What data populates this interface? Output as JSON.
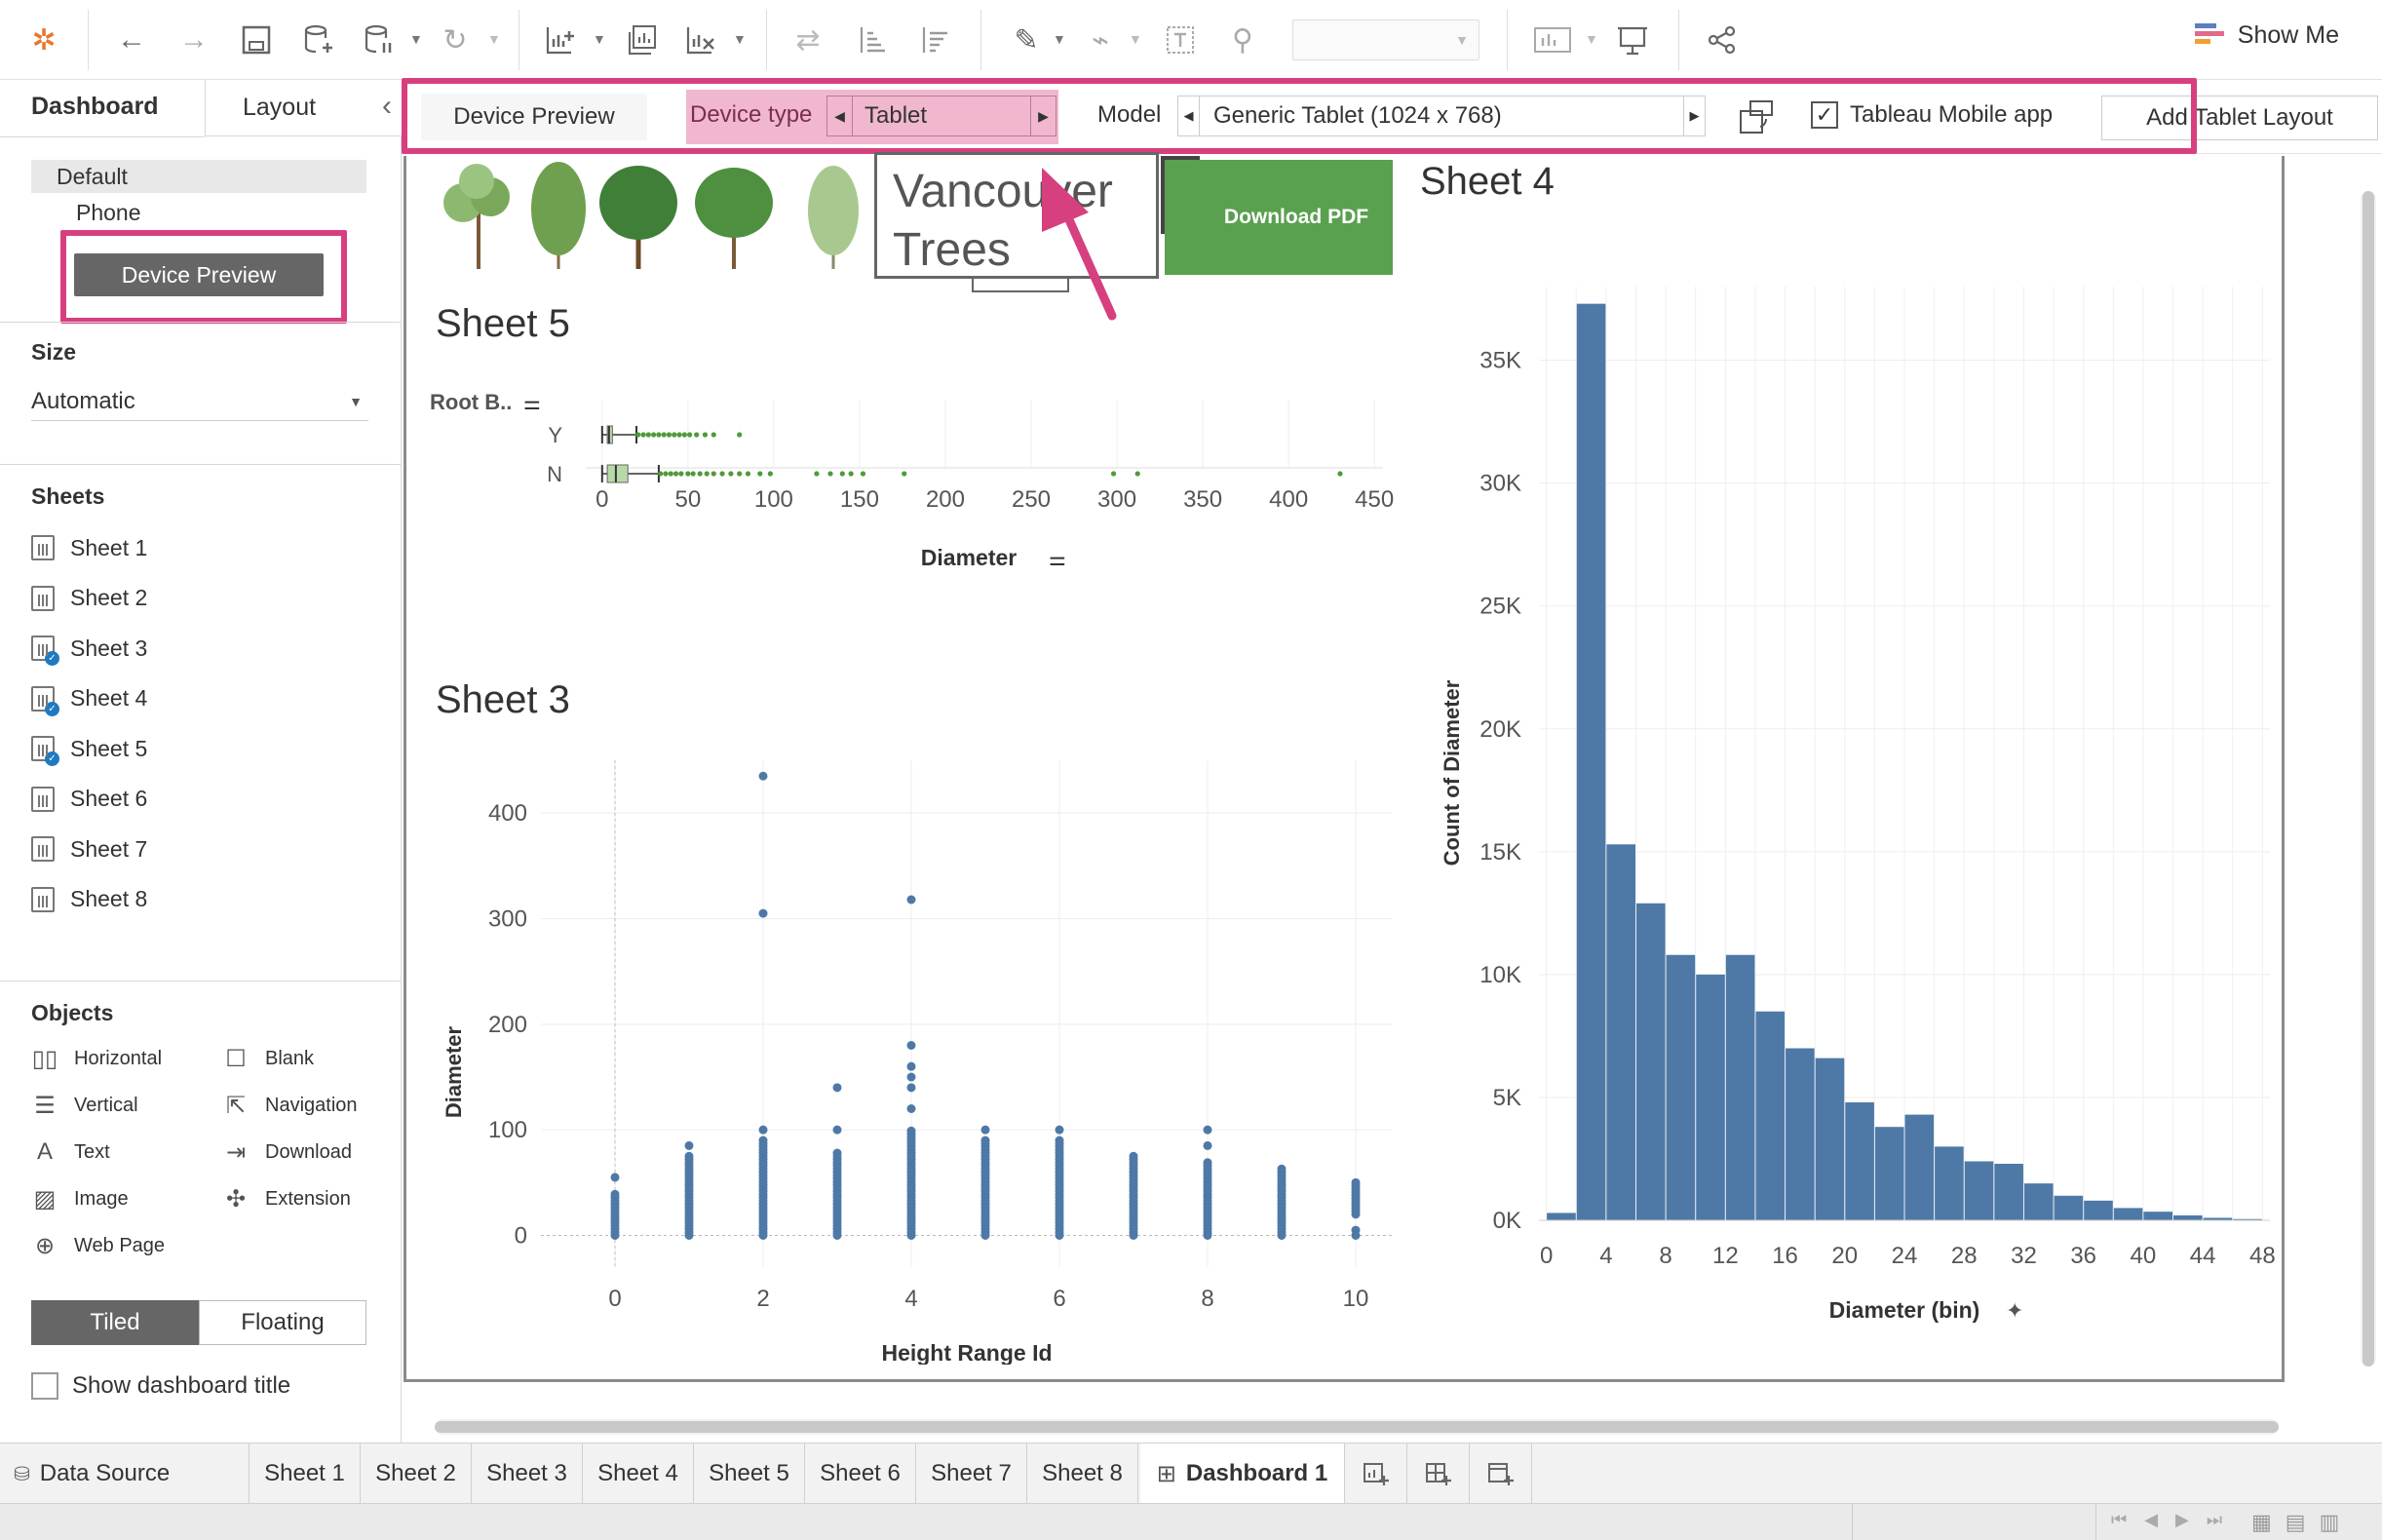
{
  "toolbar": {
    "show_me_label": "Show Me",
    "field_dropdown_value": "",
    "icons": [
      "tableau-logo-icon",
      "back-arrow-icon",
      "forward-arrow-icon",
      "save-icon",
      "new-datasource-icon",
      "pause-update-icon",
      "refresh-icon",
      "new-worksheet-icon",
      "duplicate-sheet-icon",
      "clear-sheet-icon",
      "swap-axes-icon",
      "sort-ascending-icon",
      "sort-descending-icon",
      "highlight-pen-icon",
      "group-paperclip-icon",
      "label-text-icon",
      "fix-axes-pin-icon",
      "show-cards-icon",
      "presentation-icon",
      "share-icon"
    ]
  },
  "left_panel": {
    "tabs": {
      "dashboard": "Dashboard",
      "layout": "Layout",
      "collapse_glyph": "‹"
    },
    "device_list": [
      "Default",
      "Phone"
    ],
    "device_preview_button": "Device Preview",
    "size": {
      "title": "Size",
      "value": "Automatic"
    },
    "sheets": {
      "title": "Sheets",
      "items": [
        {
          "label": "Sheet 1",
          "in_use": false
        },
        {
          "label": "Sheet 2",
          "in_use": false
        },
        {
          "label": "Sheet 3",
          "in_use": true
        },
        {
          "label": "Sheet 4",
          "in_use": true
        },
        {
          "label": "Sheet 5",
          "in_use": true
        },
        {
          "label": "Sheet 6",
          "in_use": false
        },
        {
          "label": "Sheet 7",
          "in_use": false
        },
        {
          "label": "Sheet 8",
          "in_use": false
        }
      ]
    },
    "objects": {
      "title": "Objects",
      "items": [
        {
          "label": "Horizontal",
          "icon": "horizontal-container-icon"
        },
        {
          "label": "Blank",
          "icon": "blank-icon"
        },
        {
          "label": "Vertical",
          "icon": "vertical-container-icon"
        },
        {
          "label": "Navigation",
          "icon": "navigation-icon"
        },
        {
          "label": "Text",
          "icon": "text-icon"
        },
        {
          "label": "Download",
          "icon": "download-icon"
        },
        {
          "label": "Image",
          "icon": "image-icon"
        },
        {
          "label": "Extension",
          "icon": "extension-icon"
        },
        {
          "label": "Web Page",
          "icon": "web-page-icon"
        }
      ]
    },
    "layout_toggle": {
      "tiled": "Tiled",
      "floating": "Floating"
    },
    "show_title": "Show dashboard title"
  },
  "device_bar": {
    "device_preview_label": "Device Preview",
    "device_type_label": "Device type",
    "device_type_value": "Tablet",
    "model_label": "Model",
    "model_value": "Generic Tablet (1024 x 768)",
    "mobile_app_label": "Tableau Mobile app",
    "mobile_app_checked": true,
    "add_layout_button": "Add Tablet Layout"
  },
  "dashboard": {
    "header_title_line1": "Vancouver",
    "header_title_line2": "Trees",
    "download_pdf": "Download PDF",
    "close_glyph": "✕",
    "menu_glyph": "▾"
  },
  "highlight_color": "#d6407f",
  "chart_data": [
    {
      "name": "Sheet 5",
      "type": "box",
      "title": "Sheet 5",
      "row_header": "Root B..",
      "categories": [
        "Y",
        "N"
      ],
      "xlabel": "Diameter",
      "x_ticks": [
        0,
        50,
        100,
        150,
        200,
        250,
        300,
        350,
        400,
        450
      ],
      "xlim": [
        -5,
        455
      ],
      "boxes": [
        {
          "category": "Y",
          "q1": 3,
          "median": 4,
          "q3": 6,
          "whisker_low": 0,
          "whisker_high": 20
        },
        {
          "category": "N",
          "q1": 3,
          "median": 8,
          "q3": 15,
          "whisker_low": 0,
          "whisker_high": 33
        }
      ],
      "outliers": [
        {
          "category": "Y",
          "values": [
            21,
            24,
            27,
            30,
            33,
            36,
            39,
            42,
            45,
            48,
            51,
            55,
            60,
            65,
            80
          ]
        },
        {
          "category": "N",
          "values": [
            34,
            37,
            40,
            43,
            46,
            50,
            53,
            57,
            61,
            65,
            70,
            75,
            80,
            85,
            92,
            98,
            125,
            133,
            140,
            145,
            152,
            176,
            298,
            312,
            430
          ]
        }
      ],
      "colors": {
        "box": "#b7d9a8",
        "outlier": "#4f9a3a"
      }
    },
    {
      "name": "Sheet 3",
      "type": "scatter",
      "title": "Sheet 3",
      "xlabel": "Height Range Id",
      "ylabel": "Diameter",
      "x_ticks": [
        0,
        2,
        4,
        6,
        8,
        10
      ],
      "y_ticks": [
        0,
        100,
        200,
        300,
        400
      ],
      "xlim": [
        -1,
        10.5
      ],
      "ylim": [
        -30,
        450
      ],
      "color": "#4e79a7",
      "points": [
        {
          "x": 0,
          "y_min": 0,
          "y_max": 40,
          "extra": [
            55
          ]
        },
        {
          "x": 1,
          "y_min": 0,
          "y_max": 75,
          "extra": [
            85
          ]
        },
        {
          "x": 2,
          "y_min": 0,
          "y_max": 90,
          "extra": [
            100,
            305,
            435
          ]
        },
        {
          "x": 3,
          "y_min": 0,
          "y_max": 80,
          "extra": [
            100,
            140
          ]
        },
        {
          "x": 4,
          "y_min": 0,
          "y_max": 100,
          "extra": [
            120,
            140,
            150,
            160,
            180,
            318
          ]
        },
        {
          "x": 5,
          "y_min": 0,
          "y_max": 90,
          "extra": [
            100
          ]
        },
        {
          "x": 6,
          "y_min": 0,
          "y_max": 90,
          "extra": [
            100
          ]
        },
        {
          "x": 7,
          "y_min": 0,
          "y_max": 75,
          "extra": []
        },
        {
          "x": 8,
          "y_min": 0,
          "y_max": 70,
          "extra": [
            85,
            100
          ]
        },
        {
          "x": 9,
          "y_min": 0,
          "y_max": 65,
          "extra": []
        },
        {
          "x": 10,
          "y_min": 20,
          "y_max": 50,
          "extra": [
            5,
            0
          ]
        }
      ]
    },
    {
      "name": "Sheet 4",
      "type": "bar",
      "title": "Sheet 4",
      "xlabel": "Diameter (bin)",
      "ylabel": "Count of Diameter",
      "x_ticks": [
        0,
        4,
        8,
        12,
        16,
        20,
        24,
        28,
        32,
        36,
        40,
        44,
        48
      ],
      "y_ticks": [
        "0K",
        "5K",
        "10K",
        "15K",
        "20K",
        "25K",
        "30K",
        "35K"
      ],
      "ylim": [
        0,
        38000
      ],
      "bin_width": 2,
      "bins": [
        0,
        2,
        4,
        6,
        8,
        10,
        12,
        14,
        16,
        18,
        20,
        22,
        24,
        26,
        28,
        30,
        32,
        34,
        36,
        38,
        40,
        42,
        44,
        46
      ],
      "values": [
        300,
        37300,
        15300,
        12900,
        10800,
        10000,
        10800,
        8500,
        7000,
        6600,
        4800,
        3800,
        4300,
        3000,
        2400,
        2300,
        1500,
        1000,
        800,
        500,
        350,
        200,
        100,
        50
      ],
      "color": "#4e79a7"
    }
  ],
  "bottom_tabs": {
    "data_source": "Data Source",
    "sheets": [
      "Sheet 1",
      "Sheet 2",
      "Sheet 3",
      "Sheet 4",
      "Sheet 5",
      "Sheet 6",
      "Sheet 7",
      "Sheet 8"
    ],
    "active": "Dashboard 1"
  }
}
